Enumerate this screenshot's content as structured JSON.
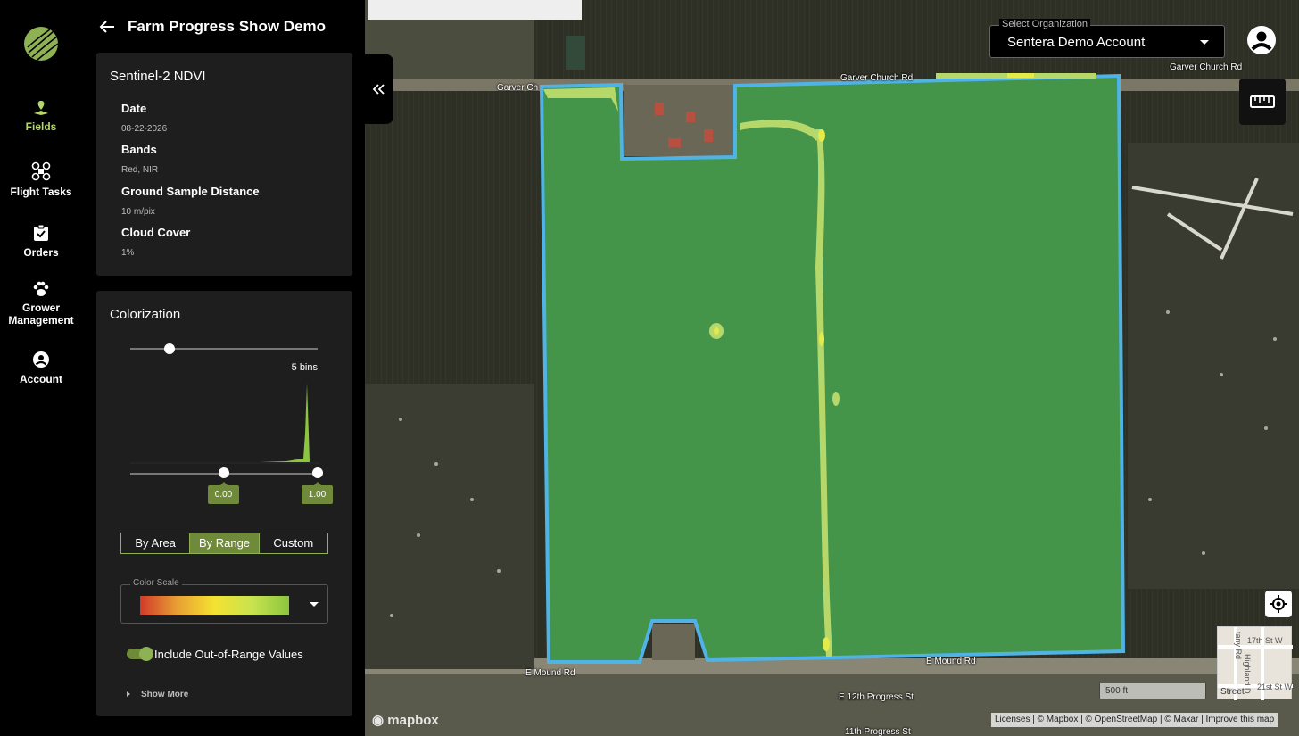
{
  "nav": {
    "items": [
      {
        "label": "Fields",
        "icon": "fields-icon",
        "active": true
      },
      {
        "label": "Flight Tasks",
        "icon": "drone-icon",
        "active": false
      },
      {
        "label": "Orders",
        "icon": "clipboard-icon",
        "active": false
      },
      {
        "label": "Grower Management",
        "icon": "paw-icon",
        "active": false
      },
      {
        "label": "Account",
        "icon": "account-icon",
        "active": false
      }
    ]
  },
  "panel": {
    "title": "Farm Progress Show Demo",
    "info": {
      "title": "Sentinel-2 NDVI",
      "fields": [
        {
          "label": "Date",
          "value": "08-22-2026"
        },
        {
          "label": "Bands",
          "value": "Red, NIR"
        },
        {
          "label": "Ground Sample Distance",
          "value": "10 m/pix"
        },
        {
          "label": "Cloud Cover",
          "value": "1%"
        }
      ]
    },
    "colorization": {
      "title": "Colorization",
      "bins_label": "5 bins",
      "range_min": "0.00",
      "range_max": "1.00",
      "tabs": [
        "By Area",
        "By Range",
        "Custom"
      ],
      "active_tab": "By Range",
      "color_scale_label": "Color Scale",
      "toggle_label": "Include Out-of-Range Values",
      "toggle_on": true,
      "show_more": "Show More"
    }
  },
  "map": {
    "org_legend": "Select Organization",
    "org_value": "Sentera Demo Account",
    "roads": {
      "garver_left": "Garver Ch",
      "garver_mid": "Garver Church Rd",
      "garver_right": "Garver Church Rd",
      "mound_left": "E Mound Rd",
      "mound_right": "E Mound Rd",
      "progress_12": "E 12th Progress St",
      "progress_11": "11th Progress St"
    },
    "scale_label": "500 ft",
    "street_label": "Street",
    "thumb_labels": [
      "17th St W",
      "Highland D",
      "tany Rd",
      "21st St W"
    ],
    "mapbox": "mapbox",
    "attribution": "Licenses | © Mapbox | © OpenStreetMap | © Maxar | Improve this map",
    "accent": "#b6d86b",
    "field_fill": "#44944a",
    "boundary": "#4fb3e6"
  }
}
